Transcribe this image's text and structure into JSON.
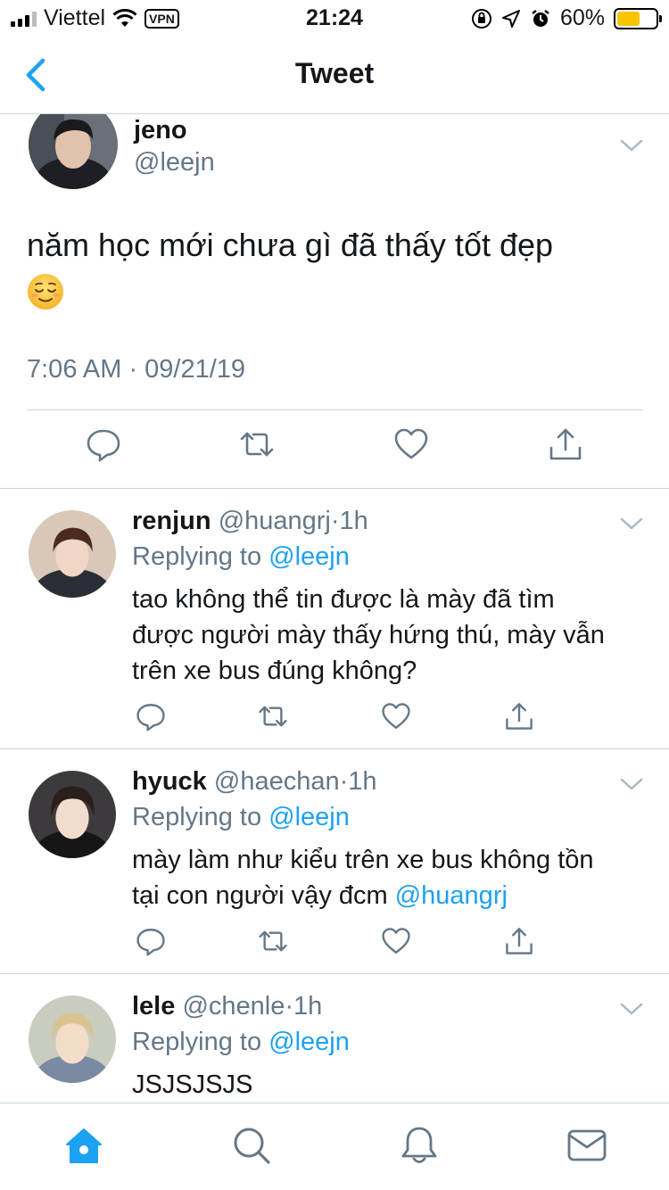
{
  "status_bar": {
    "carrier": "Viettel",
    "vpn": "VPN",
    "time": "21:24",
    "battery": "60%",
    "battery_level": 0.6,
    "battery_color": "#f7c400"
  },
  "header": {
    "title": "Tweet",
    "back_icon": "chevron-left-icon"
  },
  "main_tweet": {
    "name": "jeno",
    "handle": "@leejn",
    "text": "năm học mới chưa gì đã thấy tốt đẹp",
    "emoji": "relieved-face-emoji",
    "time": "7:06 AM · 09/21/19",
    "actions": [
      "reply-icon",
      "retweet-icon",
      "like-icon",
      "share-icon"
    ]
  },
  "replies": [
    {
      "name": "renjun",
      "handle": "@huangrj",
      "dot": "·",
      "ago": "1h",
      "replying_prefix": "Replying to",
      "replying_to": "@leejn",
      "text_line1": "tao không thể tin được là mày đã tìm",
      "text_line2": "được người mày thấy hứng thú, mày vẫn",
      "text_line3": "trên xe bus đúng không?"
    },
    {
      "name": "hyuck",
      "handle": "@haechan",
      "dot": "·",
      "ago": "1h",
      "replying_prefix": "Replying to",
      "replying_to": "@leejn",
      "text_line1": "mày làm như kiểu trên xe bus không tồn",
      "text_line2": "tại con người vậy đcm",
      "text_mention": "@huangrj"
    },
    {
      "name": "lele",
      "handle": "@chenle",
      "dot": "·",
      "ago": "1h",
      "replying_prefix": "Replying to",
      "replying_to": "@leejn",
      "text_line1": "JSJSJSJS"
    }
  ],
  "tabbar": {
    "items": [
      "home-icon",
      "search-icon",
      "notifications-icon",
      "messages-icon"
    ],
    "active": "home-icon"
  },
  "colors": {
    "accent": "#1da1f2",
    "secondary_text": "#657786",
    "divider": "#ccd6dd",
    "primary_text": "#14171a"
  }
}
